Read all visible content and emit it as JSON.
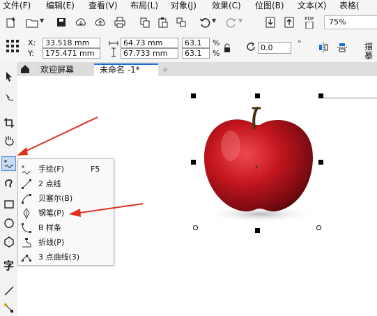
{
  "menubar": {
    "items": [
      "文件(F)",
      "编辑(E)",
      "查看(V)",
      "布局(L)",
      "对象(J)",
      "效果(C)",
      "位图(B)",
      "文本(X)",
      "表格("
    ]
  },
  "toolbar": {
    "icons": [
      "new-document-icon",
      "open-folder-icon",
      "save-icon",
      "cloud-download-icon",
      "cloud-upload-icon",
      "print-icon",
      "copy-icon",
      "paste-icon",
      "undo-icon",
      "redo-icon",
      "import-icon",
      "export-icon",
      "publish-pdf-icon"
    ],
    "pdf_label": "PDF",
    "zoom_value": "75%"
  },
  "propbar": {
    "x_label": "X:",
    "y_label": "Y:",
    "x_value": "33.518 mm",
    "y_value": "175.471 mm",
    "width_value": "64.73 mm",
    "height_value": "67.733 mm",
    "scale_x": "63.1",
    "scale_y": "63.1",
    "percent": "%",
    "rotation_value": "0.0",
    "rotation_unit": "°",
    "trace_label": "描摹"
  },
  "tabs": {
    "welcome": "欢迎屏幕",
    "document": "未命名 -1*",
    "add": "+"
  },
  "flyout": {
    "items": [
      {
        "label": "手绘(F)",
        "shortcut": "F5",
        "icon": "freehand-icon"
      },
      {
        "label": "2 点线",
        "shortcut": "",
        "icon": "two-point-line-icon"
      },
      {
        "label": "贝塞尔(B)",
        "shortcut": "",
        "icon": "bezier-icon"
      },
      {
        "label": "钢笔(P)",
        "shortcut": "",
        "icon": "pen-icon"
      },
      {
        "label": "B 样条",
        "shortcut": "",
        "icon": "b-spline-icon"
      },
      {
        "label": "折线(P)",
        "shortcut": "",
        "icon": "polyline-icon"
      },
      {
        "label": "3 点曲线(3)",
        "shortcut": "",
        "icon": "three-point-curve-icon"
      }
    ]
  },
  "toolbox": {
    "text_tool_glyph": "字"
  },
  "colors": {
    "annotation_arrow": "#e0301e",
    "apple_red": "#b3121d",
    "accent": "#1a6fd1"
  }
}
